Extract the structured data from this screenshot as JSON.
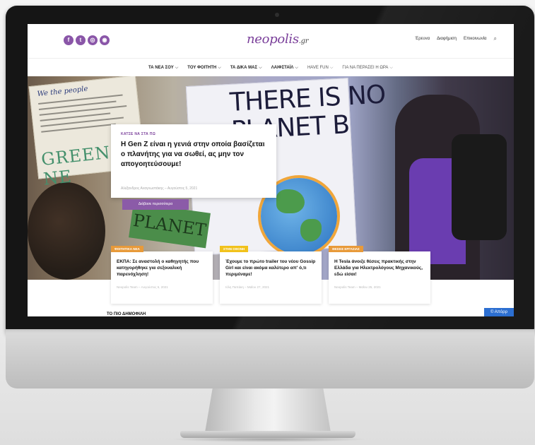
{
  "social": {
    "icons": [
      "facebook-icon",
      "twitter-icon",
      "instagram-icon",
      "podcast-icon"
    ],
    "glyphs": [
      "f",
      "t",
      "◎",
      "◉"
    ],
    "color": "#8a56a8"
  },
  "logo": {
    "name": "neopolis",
    "tld": ".gr"
  },
  "toplinks": [
    "Έρευνα",
    "Διαφήμιση",
    "Επικοινωνία"
  ],
  "nav": [
    {
      "label": "ΤΑ ΝΕΑ ΣΟΥ",
      "chev": "⌵"
    },
    {
      "label": "ΤΟΥ ΦΟΙΤΗΤΗ",
      "chev": "⌵"
    },
    {
      "label": "ΤΑ ΔΙΚΑ ΜΑΣ",
      "chev": "⌵"
    },
    {
      "label": "ΛΑΙΦΣΤΑΪΛ",
      "chev": "⌵"
    },
    {
      "label": "HAVE FUN",
      "chev": "⌵"
    },
    {
      "label": "ΓΙΑ ΝΑ ΠΕΡΑΣΕΙ Η ΩΡΑ",
      "chev": "⌵"
    }
  ],
  "hero": {
    "sign_left_text": "GREEN NE",
    "sign_left_header": "We the people",
    "sign_right_text": "THERE IS NO\nPLANET B",
    "sign_green_text": "PLANET",
    "feature": {
      "category": "ΚΑΤΣΕ ΝΑ ΣΤΑ ΠΩ",
      "title": "Η Gen Z είναι η γενιά στην οποία βασίζεται ο πλανήτης για να σωθεί, ας μην τον απογοητεύσουμε!",
      "meta": "Αλέξανδρος Αναγνωστάκης – Αυγούστος 5, 2021",
      "button": "Διάβασε περισσότερα"
    }
  },
  "cards": [
    {
      "badge": "ΦΟΙΤΗΤΙΚΑ ΝΕΑ",
      "title": "ΕΚΠΑ: Σε αναστολή ο καθηγητής που κατηγορήθηκε για σεξουαλική παρενόχληση!",
      "meta": "Neopolis Team – Αυγούστος 5, 2021"
    },
    {
      "badge": "ΣΤΗΝ ΟΘΟΝΗ",
      "title": "Έχουμε το πρώτο trailer του νέου Gossip Girl και είναι ακόμα καλύτερο απ' ό,τι περιμέναμε!",
      "meta": "Ιόλη Παπάκη – Μαΐου 27, 2021"
    },
    {
      "badge": "ΘΕΣΕΙΣ ΕΡΓΑΣΙΑΣ",
      "title": "Η Tesla άνοιξε θέσεις πρακτικής στην Ελλάδα για Ηλεκτρολόγους Μηχανικούς, εδώ είσαι!",
      "meta": "Neopolis Team – Μαΐου 25, 2021"
    }
  ],
  "below_heading": "ΤΟ ΠΙΟ ΔΗΜΟΦΙΛΗ",
  "cookie_btn": "© Απόρρ",
  "colors": {
    "accent": "#7a3f9a",
    "badge_orange": "#e89a3a",
    "badge_yellow": "#f1c21c",
    "cookie": "#2c6fd1"
  }
}
